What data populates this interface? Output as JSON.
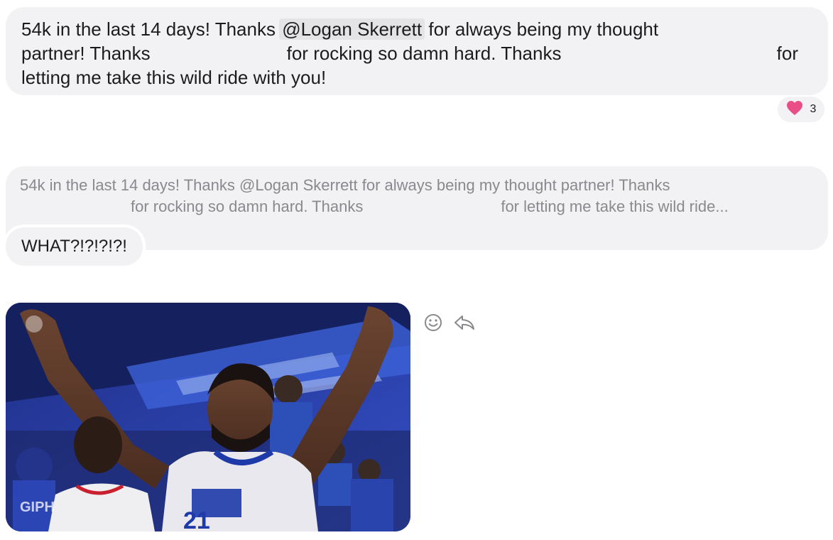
{
  "message": {
    "line1_before": "54k in the last 14 days! Thanks ",
    "mention": "@Logan Skerrett",
    "line1_after": " for always being my thought",
    "line2_a": "partner! Thanks",
    "line2_b": "for rocking so damn hard. Thanks",
    "line2_c": "for",
    "line3": "letting me take this wild ride with you!",
    "reaction_count": "3"
  },
  "quote": {
    "line1": "54k in the last 14 days! Thanks @Logan Skerrett for always being my thought partner! Thanks",
    "line2_a": "for rocking so damn hard. Thanks",
    "line2_b": "for letting me take this wild ride..."
  },
  "reply": {
    "text": "WHAT?!?!?!?!"
  },
  "gif": {
    "watermark": "GIPH",
    "jersey_number": "21"
  },
  "icons": {
    "reaction": "heart-icon",
    "emoji": "emoji-icon",
    "reply": "reply-icon"
  },
  "colors": {
    "heart": "#e94f86",
    "bubble": "#f2f2f4",
    "quote_text": "#8a8a8e"
  }
}
